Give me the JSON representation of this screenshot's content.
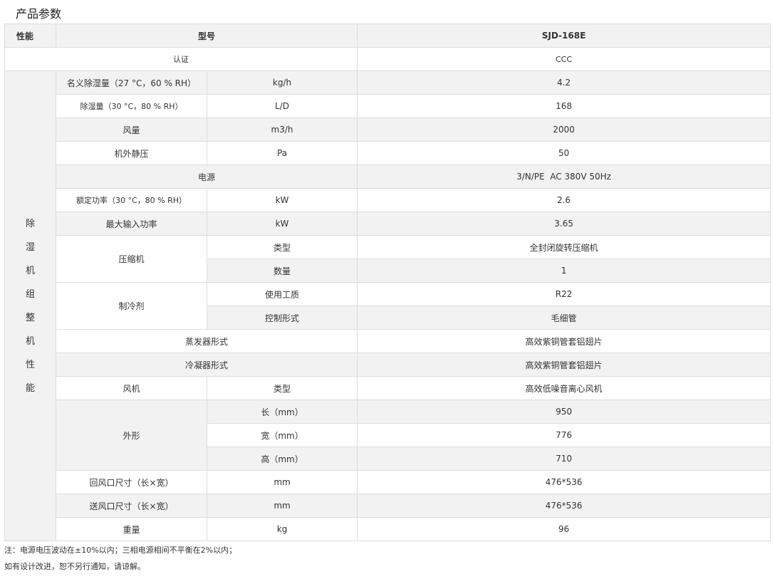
{
  "page_title": "产品参数",
  "header": {
    "c1": "性能",
    "c2": "型号",
    "c3": "SJD-168E"
  },
  "cert": {
    "label": "认证",
    "value": "CCC"
  },
  "side_label_chars": [
    "除",
    "湿",
    "机",
    "组",
    "整",
    "机",
    "性",
    "能"
  ],
  "rows": {
    "r1": {
      "name": "名义除湿量（27 °C，60 % RH）",
      "unit": "kg/h",
      "value": "4.2"
    },
    "r2": {
      "name": "除湿量（30 °C，80 % RH）",
      "unit": "L/D",
      "value": "168"
    },
    "r3": {
      "name": "风量",
      "unit": "m3/h",
      "value": "2000"
    },
    "r4": {
      "name": "机外静压",
      "unit": "Pa",
      "value": "50"
    },
    "r5": {
      "name": "电源",
      "value": "3/N/PE  AC 380V 50Hz"
    },
    "r6": {
      "name": "额定功率（30 °C，80 % RH）",
      "unit": "kW",
      "value": "2.6"
    },
    "r7": {
      "name": "最大输入功率",
      "unit": "kW",
      "value": "3.65"
    },
    "compressor": {
      "name": "压缩机",
      "type_label": "类型",
      "type_value": "全封闭旋转压缩机",
      "qty_label": "数量",
      "qty_value": "1"
    },
    "refrigerant": {
      "name": "制冷剂",
      "medium_label": "使用工质",
      "medium_value": "R22",
      "control_label": "控制形式",
      "control_value": "毛细管"
    },
    "evaporator": {
      "name": "蒸发器形式",
      "value": "高效紫铜管套铝翅片"
    },
    "condenser": {
      "name": "冷凝器形式",
      "value": "高效紫铜管套铝翅片"
    },
    "fan": {
      "name": "风机",
      "type_label": "类型",
      "value": "高效低噪音离心风机"
    },
    "shape": {
      "name": "外形",
      "length_label": "长（mm）",
      "length_value": "950",
      "width_label": "宽（mm）",
      "width_value": "776",
      "height_label": "高（mm）",
      "height_value": "710"
    },
    "return_air": {
      "name": "回风口尺寸（长×宽）",
      "unit": "mm",
      "value": "476*536"
    },
    "supply_air": {
      "name": "送风口尺寸（长×宽）",
      "unit": "mm",
      "value": "476*536"
    },
    "weight": {
      "name": "重量",
      "unit": "kg",
      "value": "96"
    }
  },
  "notes": [
    "注：电源电压波动在±10%以内；三相电源相间不平衡在2%以内；",
    "如有设计改进，恕不另行通知，请谅解。"
  ]
}
